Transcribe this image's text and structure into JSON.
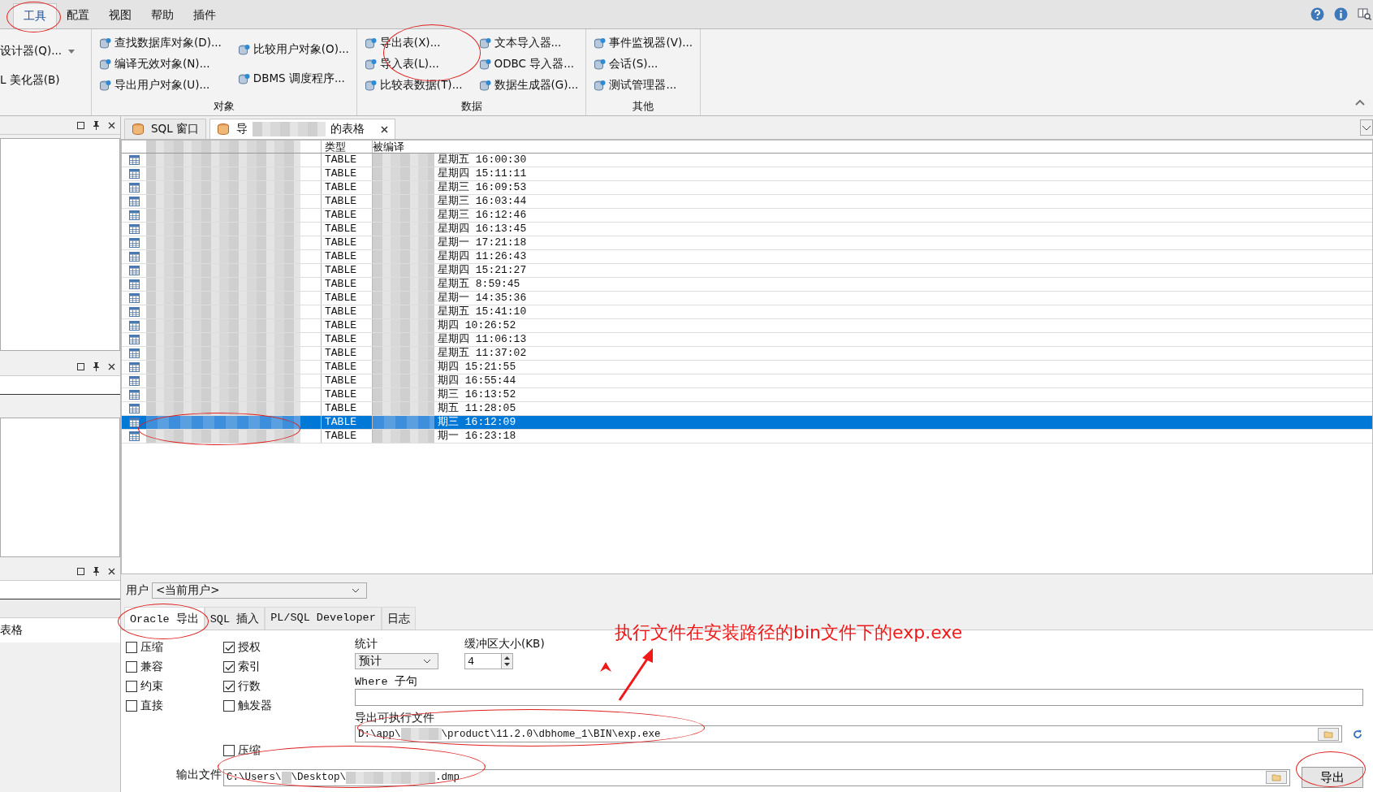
{
  "menu": {
    "tabs": [
      {
        "label": "工具",
        "selected": true
      },
      {
        "label": "配置",
        "selected": false
      },
      {
        "label": "视图",
        "selected": false
      },
      {
        "label": "帮助",
        "selected": false
      },
      {
        "label": "插件",
        "selected": false
      }
    ]
  },
  "ribbon": {
    "leading_items": [
      {
        "label": "设计器(Q)...",
        "dropdown": true
      },
      {
        "label": "L 美化器(B)",
        "dropdown": false
      }
    ],
    "groups": [
      {
        "title": "对象",
        "columns": [
          [
            "查找数据库对象(D)...",
            "编译无效对象(N)...",
            "导出用户对象(U)..."
          ],
          [
            "比较用户对象(O)...",
            "DBMS 调度程序..."
          ]
        ]
      },
      {
        "title": "数据",
        "columns": [
          [
            "导出表(X)...",
            "导入表(L)...",
            "比较表数据(T)..."
          ],
          [
            "文本导入器...",
            "ODBC 导入器...",
            "数据生成器(G)..."
          ]
        ]
      },
      {
        "title": "其他",
        "columns": [
          [
            "事件监视器(V)...",
            "会话(S)...",
            "测试管理器..."
          ]
        ]
      }
    ]
  },
  "left_panel": {
    "list_item": "表格"
  },
  "doc_tabs": [
    {
      "parts": [
        "SQL 窗口"
      ],
      "selected": false,
      "closable": false
    },
    {
      "parts": [
        "导",
        "的表格"
      ],
      "selected": true,
      "closable": true
    }
  ],
  "table": {
    "headers": {
      "type": "类型",
      "compiled": "被编译"
    },
    "rows": [
      {
        "type": "TABLE",
        "compiled": "星期五 16:00:30",
        "selected": false
      },
      {
        "type": "TABLE",
        "compiled": "星期四 15:11:11",
        "selected": false
      },
      {
        "type": "TABLE",
        "compiled": "星期三 16:09:53",
        "selected": false
      },
      {
        "type": "TABLE",
        "compiled": "星期三 16:03:44",
        "selected": false
      },
      {
        "type": "TABLE",
        "compiled": "星期三 16:12:46",
        "selected": false
      },
      {
        "type": "TABLE",
        "compiled": "星期四 16:13:45",
        "selected": false
      },
      {
        "type": "TABLE",
        "compiled": "星期一 17:21:18",
        "selected": false
      },
      {
        "type": "TABLE",
        "compiled": "星期四 11:26:43",
        "selected": false
      },
      {
        "type": "TABLE",
        "compiled": "星期四 15:21:27",
        "selected": false
      },
      {
        "type": "TABLE",
        "compiled": "星期五 8:59:45",
        "selected": false
      },
      {
        "type": "TABLE",
        "compiled": "星期一 14:35:36",
        "selected": false
      },
      {
        "type": "TABLE",
        "compiled": "星期五 15:41:10",
        "selected": false
      },
      {
        "type": "TABLE",
        "compiled": "期四 10:26:52",
        "selected": false
      },
      {
        "type": "TABLE",
        "compiled": "星期四 11:06:13",
        "selected": false
      },
      {
        "type": "TABLE",
        "compiled": "星期五 11:37:02",
        "selected": false
      },
      {
        "type": "TABLE",
        "compiled": "期四 15:21:55",
        "selected": false
      },
      {
        "type": "TABLE",
        "compiled": "期四 16:55:44",
        "selected": false
      },
      {
        "type": "TABLE",
        "compiled": "期三 16:13:52",
        "selected": false
      },
      {
        "type": "TABLE",
        "compiled": "期五 11:28:05",
        "selected": false
      },
      {
        "type": "TABLE",
        "compiled": "期三 16:12:09",
        "selected": true
      },
      {
        "type": "TABLE",
        "compiled": "期一 16:23:18",
        "selected": false
      }
    ]
  },
  "export": {
    "user": {
      "label": "用户",
      "value": "<当前用户>"
    },
    "tabs": [
      {
        "label": "Oracle 导出",
        "selected": true
      },
      {
        "label": "SQL 插入",
        "selected": false
      },
      {
        "label": "PL/SQL Developer",
        "selected": false
      },
      {
        "label": "日志",
        "selected": false
      }
    ],
    "checks_left": [
      {
        "label": "压缩",
        "checked": false
      },
      {
        "label": "兼容",
        "checked": false
      },
      {
        "label": "约束",
        "checked": false
      },
      {
        "label": "直接",
        "checked": false
      }
    ],
    "checks_right": [
      {
        "label": "授权",
        "checked": true
      },
      {
        "label": "索引",
        "checked": true
      },
      {
        "label": "行数",
        "checked": true
      },
      {
        "label": "触发器",
        "checked": false
      }
    ],
    "extra_check": {
      "label": "压缩",
      "checked": false
    },
    "stats": {
      "label": "统计",
      "value": "预计"
    },
    "buffer": {
      "label": "缓冲区大小(KB)",
      "value": "4"
    },
    "where": {
      "label": "Where 子句"
    },
    "exe": {
      "label": "导出可执行文件",
      "parts": [
        "D:\\app\\",
        "\\product\\11.2.0\\dbhome_1\\BIN\\exp.exe"
      ]
    },
    "output": {
      "label": "输出文件",
      "parts": [
        "C:\\Users\\",
        "\\Desktop\\",
        ".dmp"
      ]
    },
    "button": "导出"
  },
  "annotation": {
    "text": "执行文件在安装路径的bin文件下的exp.exe"
  }
}
